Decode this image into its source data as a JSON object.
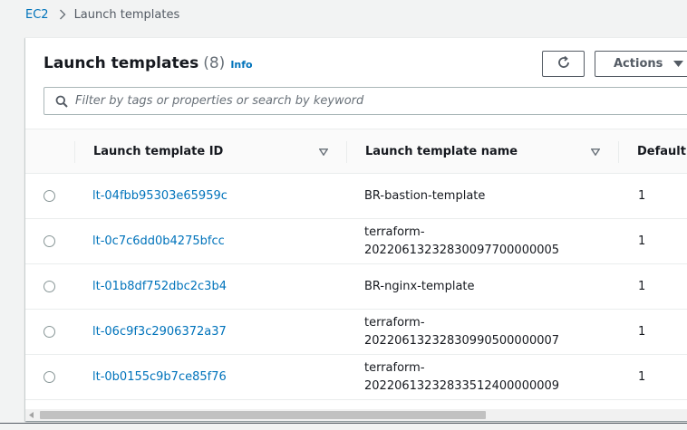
{
  "breadcrumb": {
    "root": "EC2",
    "current": "Launch templates"
  },
  "header": {
    "title": "Launch templates",
    "count": "(8)",
    "info": "Info",
    "actions_label": "Actions"
  },
  "search": {
    "placeholder": "Filter by tags or properties or search by keyword"
  },
  "table": {
    "columns": [
      "Launch template ID",
      "Launch template name",
      "Default v"
    ],
    "rows": [
      {
        "id": "lt-04fbb95303e65959c",
        "name_line1": "BR-bastion-template",
        "name_line2": "",
        "version": "1"
      },
      {
        "id": "lt-0c7c6dd0b4275bfcc",
        "name_line1": "terraform-",
        "name_line2": "20220613232830097700000005",
        "version": "1"
      },
      {
        "id": "lt-01b8df752dbc2c3b4",
        "name_line1": "BR-nginx-template",
        "name_line2": "",
        "version": "1"
      },
      {
        "id": "lt-06c9f3c2906372a37",
        "name_line1": "terraform-",
        "name_line2": "20220613232830990500000007",
        "version": "1"
      },
      {
        "id": "lt-0b0155c9b7ce85f76",
        "name_line1": "terraform-",
        "name_line2": "20220613232833512400000009",
        "version": "1"
      }
    ]
  },
  "icons": {
    "refresh": "refresh-icon",
    "search": "search-icon",
    "caret": "caret-down-icon",
    "sort": "sort-icon"
  },
  "colors": {
    "link": "#0073bb",
    "text": "#16191f",
    "muted": "#687078"
  }
}
